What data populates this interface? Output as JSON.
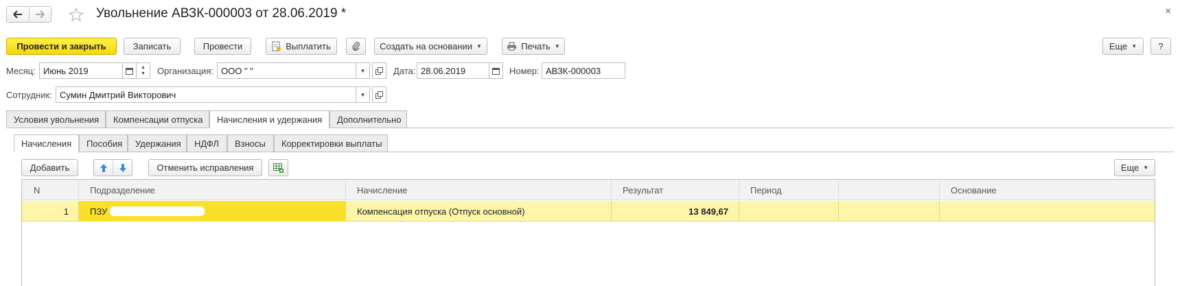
{
  "window": {
    "title": "Увольнение АВЗК-000003 от 28.06.2019 *",
    "close_glyph": "×"
  },
  "toolbar": {
    "post_close": "Провести и закрыть",
    "save": "Записать",
    "post": "Провести",
    "pay": "Выплатить",
    "create_based": "Создать на основании",
    "print": "Печать",
    "more": "Еще",
    "help": "?"
  },
  "form": {
    "month_label": "Месяц:",
    "month_value": "Июнь 2019",
    "org_label": "Организация:",
    "org_value": "ООО \"                    \"",
    "date_label": "Дата:",
    "date_value": "28.06.2019",
    "number_label": "Номер:",
    "number_value": "АВЗК-000003",
    "employee_label": "Сотрудник:",
    "employee_value": "Сумин Дмитрий Викторович"
  },
  "tabs": [
    "Условия увольнения",
    "Компенсации отпуска",
    "Начисления и удержания",
    "Дополнительно"
  ],
  "subtabs": [
    "Начисления",
    "Пособия",
    "Удержания",
    "НДФЛ",
    "Взносы",
    "Корректировки выплаты"
  ],
  "table_toolbar": {
    "add": "Добавить",
    "cancel_fix": "Отменить исправления",
    "more": "Еще"
  },
  "table": {
    "columns": [
      "N",
      "Подразделение",
      "Начисление",
      "Результат",
      "Период",
      "",
      "Основание"
    ],
    "rows": [
      {
        "n": "1",
        "division": "ПЗУ",
        "accrual": "Компенсация отпуска (Отпуск основной)",
        "result": "13 849,67",
        "period": "",
        "extra": "",
        "basis": ""
      }
    ]
  },
  "colors": {
    "primary_button": "#f5d60a",
    "selected_row": "#fdf5a8",
    "selected_cell": "#fbe02a"
  }
}
